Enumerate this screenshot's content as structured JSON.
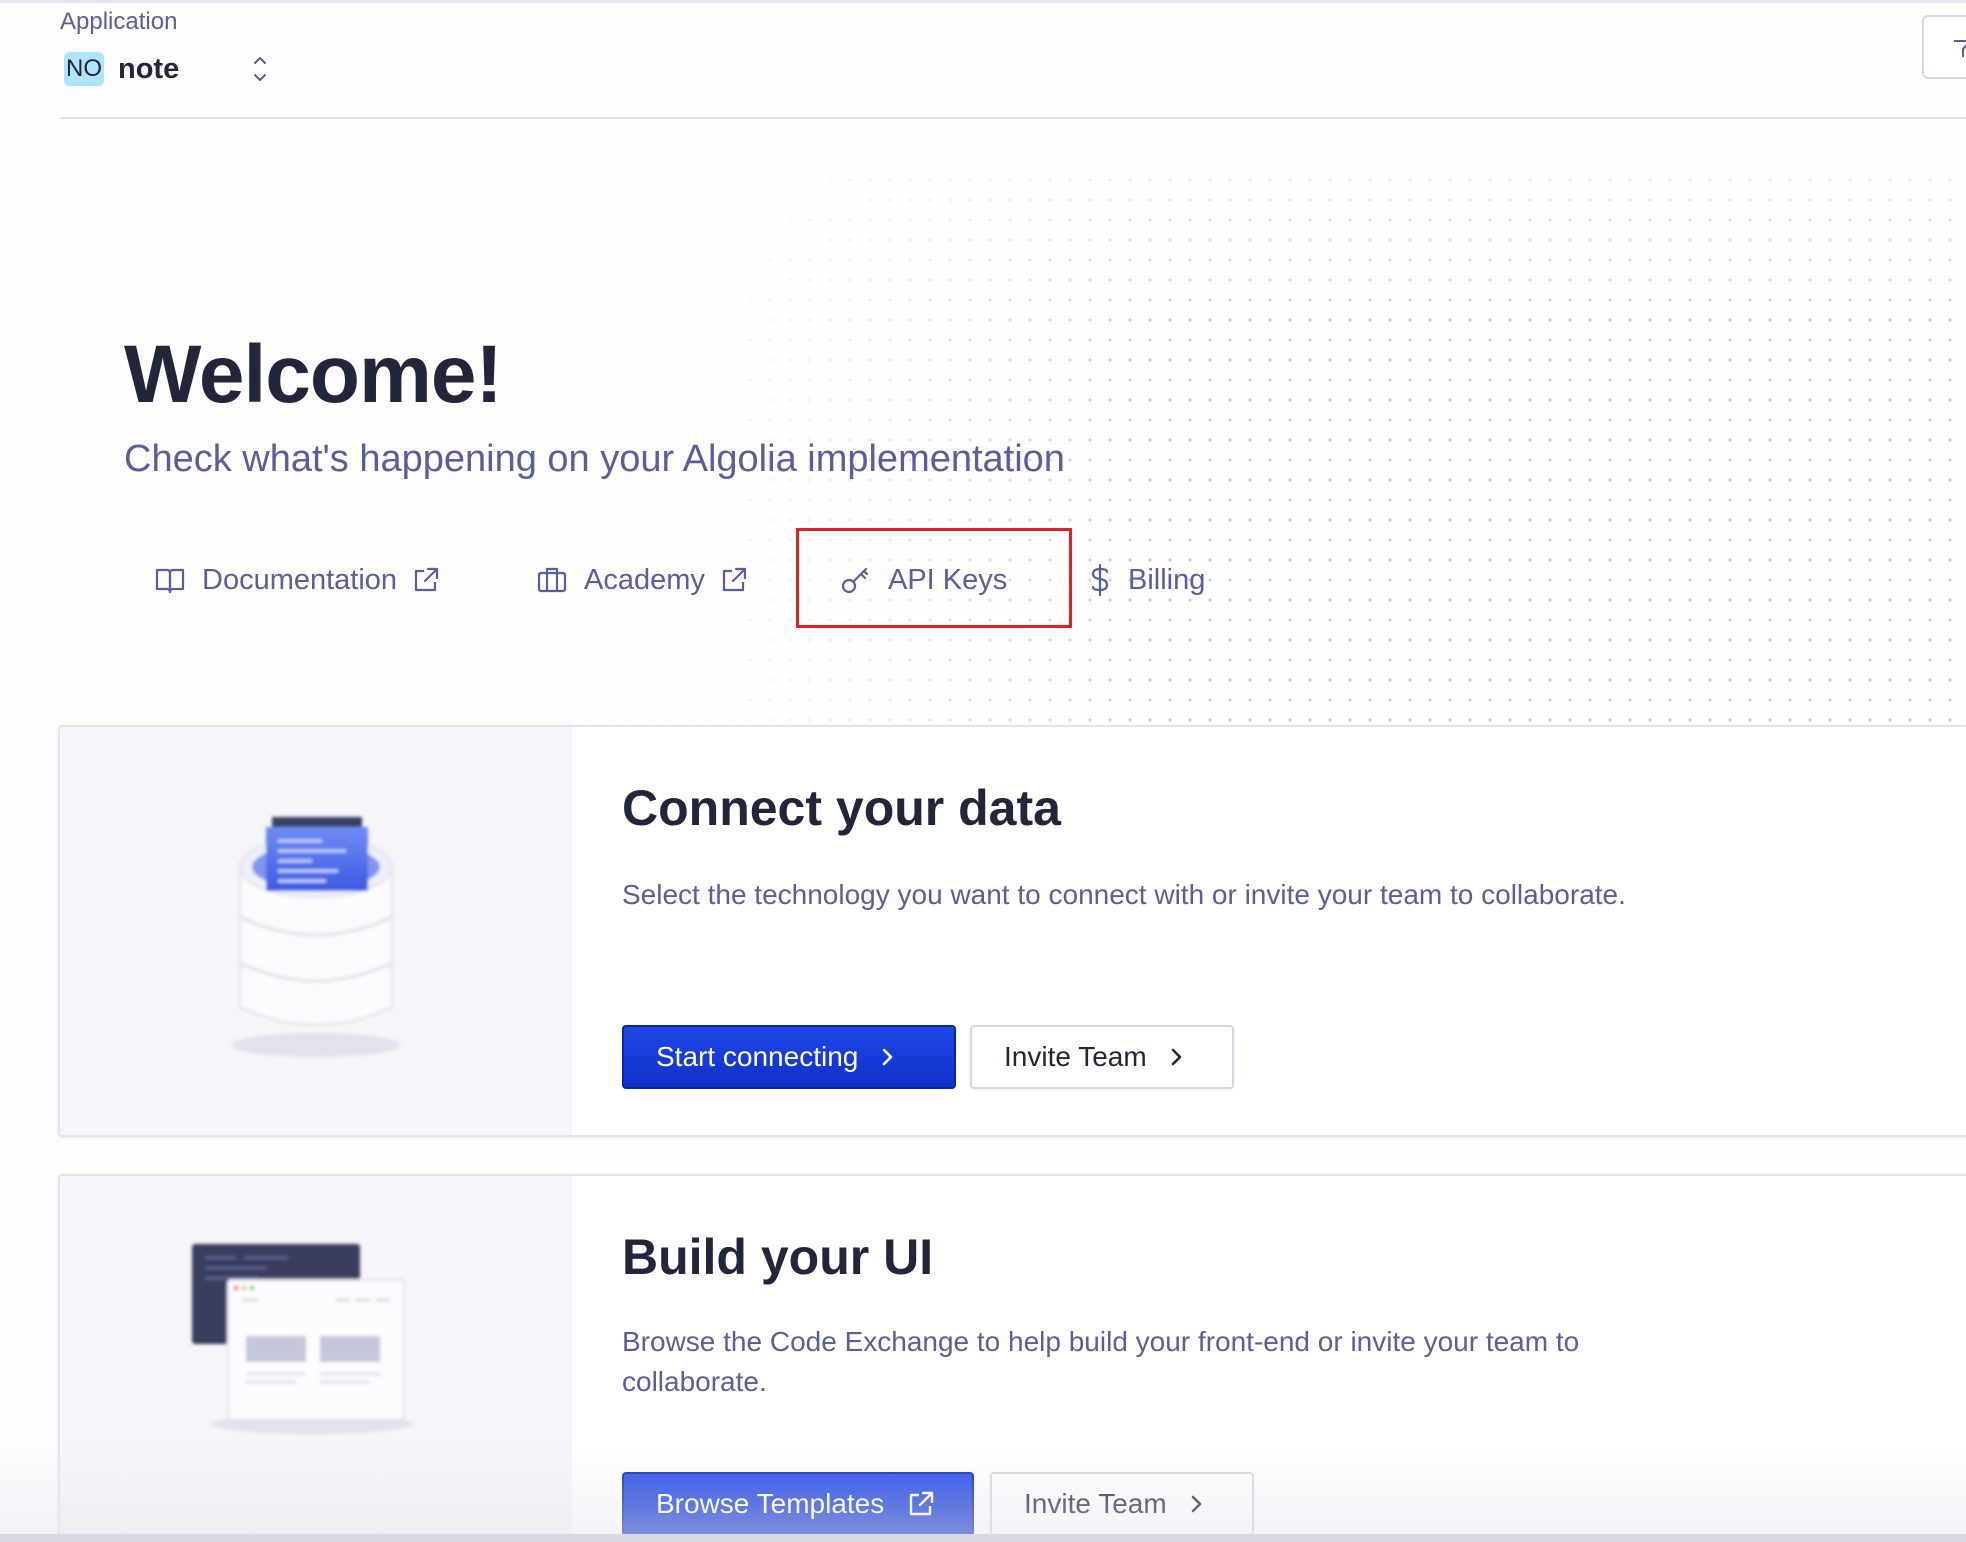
{
  "header": {
    "app_label": "Application",
    "app_badge": "NO",
    "app_name": "note"
  },
  "hero": {
    "title": "Welcome!",
    "subtitle": "Check what's happening on your Algolia implementation",
    "links": [
      {
        "label": "Documentation",
        "icon": "book-icon",
        "external": true
      },
      {
        "label": "Academy",
        "icon": "briefcase-icon",
        "external": true
      },
      {
        "label": "API Keys",
        "icon": "key-icon",
        "external": false
      },
      {
        "label": "Billing",
        "icon": "dollar-icon",
        "external": false
      }
    ]
  },
  "cards": [
    {
      "title": "Connect your data",
      "description": "Select the technology you want to connect with or invite your team to collaborate.",
      "primary_label": "Start connecting",
      "secondary_label": "Invite Team"
    },
    {
      "title": "Build your UI",
      "description": "Browse the Code Exchange to help build your front-end or invite your team to collaborate.",
      "primary_label": "Browse Templates",
      "secondary_label": "Invite Team"
    }
  ],
  "colors": {
    "primary": "#1f48e8",
    "text_dark": "#23263b",
    "text_muted": "#5a5e9a",
    "highlight": "#e0202a",
    "badge": "#aee5fb"
  }
}
